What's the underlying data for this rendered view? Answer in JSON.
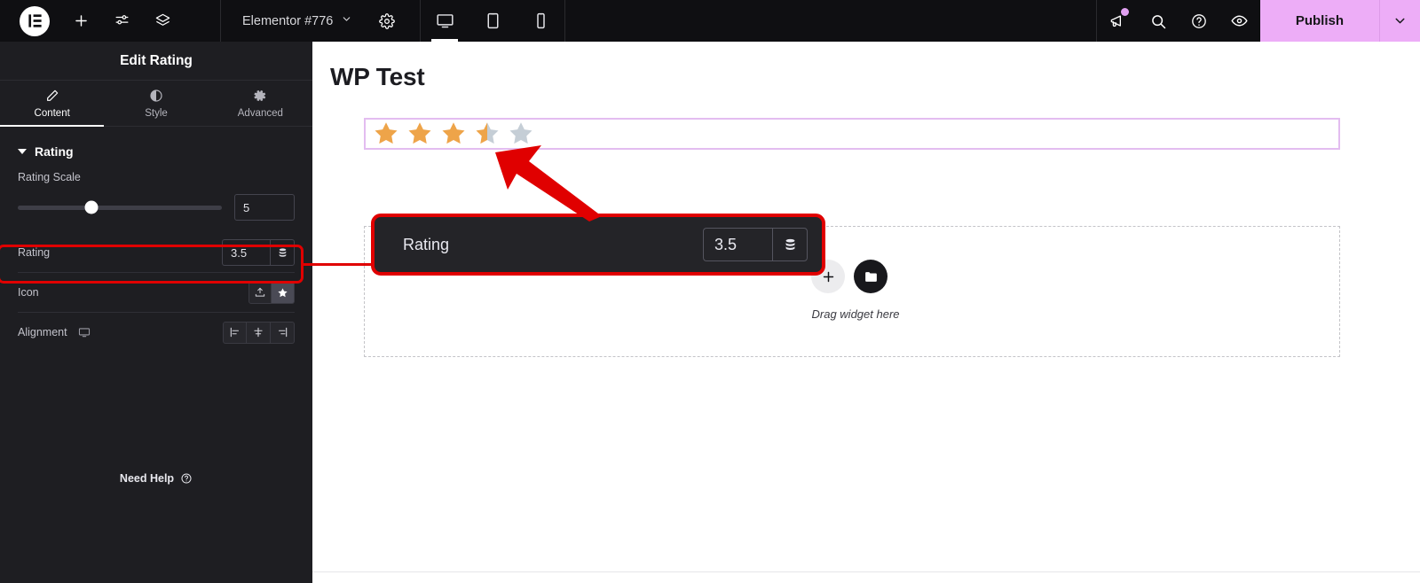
{
  "topbar": {
    "logo_icon": "elementor-logo-icon",
    "add_icon": "plus-icon",
    "settings_sliders_icon": "sliders-icon",
    "layers_icon": "layers-stack-icon",
    "document_name": "Elementor #776",
    "document_caret_icon": "chevron-down-icon",
    "page_settings_icon": "gear-icon",
    "devices": [
      {
        "name": "desktop",
        "icon": "monitor-icon",
        "active": true
      },
      {
        "name": "tablet",
        "icon": "tablet-icon",
        "active": false
      },
      {
        "name": "mobile",
        "icon": "mobile-icon",
        "active": false
      }
    ],
    "right_icons": [
      {
        "name": "whats-new-megaphone-icon",
        "badge": true
      },
      {
        "name": "search-icon",
        "badge": false
      },
      {
        "name": "help-circle-icon",
        "badge": false
      },
      {
        "name": "preview-eye-icon",
        "badge": false
      }
    ],
    "publish_label": "Publish",
    "publish_caret_icon": "chevron-down-icon",
    "publish_color": "#edadf7",
    "background_color": "#0f0f12"
  },
  "sidebar": {
    "panel_title": "Edit Rating",
    "tabs": [
      {
        "label": "Content",
        "icon": "pencil-icon",
        "active": true
      },
      {
        "label": "Style",
        "icon": "contrast-circle-icon",
        "active": false
      },
      {
        "label": "Advanced",
        "icon": "gear-icon",
        "active": false
      }
    ],
    "section": {
      "title": "Rating",
      "caret_icon": "caret-down-icon"
    },
    "controls": {
      "rating_scale": {
        "label": "Rating Scale",
        "value": "5",
        "slider_percent": 36
      },
      "rating": {
        "label": "Rating",
        "value": "3.5",
        "dynamic_tag_icon": "database-stack-icon",
        "highlighted": true
      },
      "icon": {
        "label": "Icon",
        "options": [
          {
            "name": "upload-svg-icon",
            "active": false
          },
          {
            "name": "star-icon",
            "active": true
          }
        ]
      },
      "alignment": {
        "label": "Alignment",
        "device_icon": "monitor-icon",
        "options": [
          {
            "name": "align-left-icon",
            "active": false
          },
          {
            "name": "align-center-icon",
            "active": false
          },
          {
            "name": "align-right-icon",
            "active": false
          }
        ]
      }
    },
    "need_help": {
      "label": "Need Help",
      "icon": "help-circle-icon"
    },
    "collapse_handle_icon": "chevron-left-icon",
    "background_color": "#1e1e22"
  },
  "canvas": {
    "page_title": "WP Test",
    "rating_widget": {
      "value": 3.5,
      "max": 5,
      "filled_color": "#eea449",
      "empty_color": "#c5ced6",
      "selection_border_color": "#e3bdf0",
      "stars": [
        "full",
        "full",
        "full",
        "half",
        "empty"
      ]
    },
    "dropzone": {
      "add_element_icon": "plus-icon",
      "add_template_icon": "folder-icon",
      "hint": "Drag widget here"
    }
  },
  "annotation": {
    "highlight_color": "#e00000",
    "arrow_icon": "arrow-up-left-icon",
    "magnified_callout": {
      "label": "Rating",
      "value": "3.5",
      "dynamic_tag_icon": "database-stack-icon"
    }
  }
}
